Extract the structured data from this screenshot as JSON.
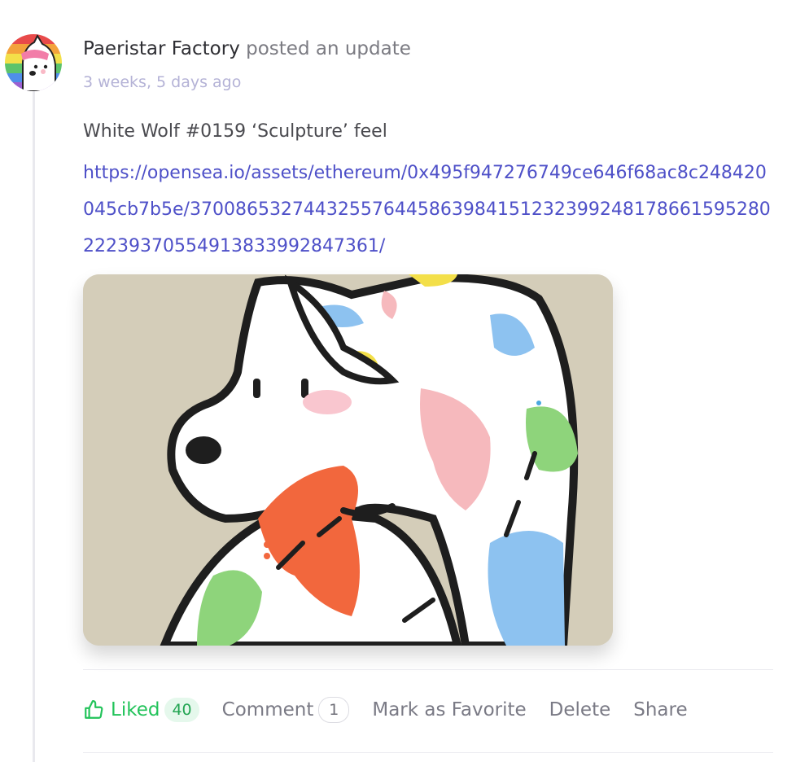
{
  "activity": {
    "author": "Paeristar Factory",
    "action": "posted an update",
    "time": "3 weeks, 5 days ago",
    "text": "White Wolf #0159 ‘Sculpture’ feel",
    "link": "https://opensea.io/assets/ethereum/0x495f947276749ce646f68ac8c248420045cb7b5e/37008653274432557644586398415123239924817866159528022239370554913833992847361/"
  },
  "actions": {
    "like_label": "Liked",
    "like_count": "40",
    "comment_label": "Comment",
    "comment_count": "1",
    "favorite_label": "Mark as Favorite",
    "delete_label": "Delete",
    "share_label": "Share"
  },
  "icons": {
    "like": "thumbs-up-icon"
  },
  "colors": {
    "link": "#4e50c8",
    "liked": "#22c35a",
    "timestamp": "#b4b2d6",
    "image_background": "#d4cdb9"
  }
}
